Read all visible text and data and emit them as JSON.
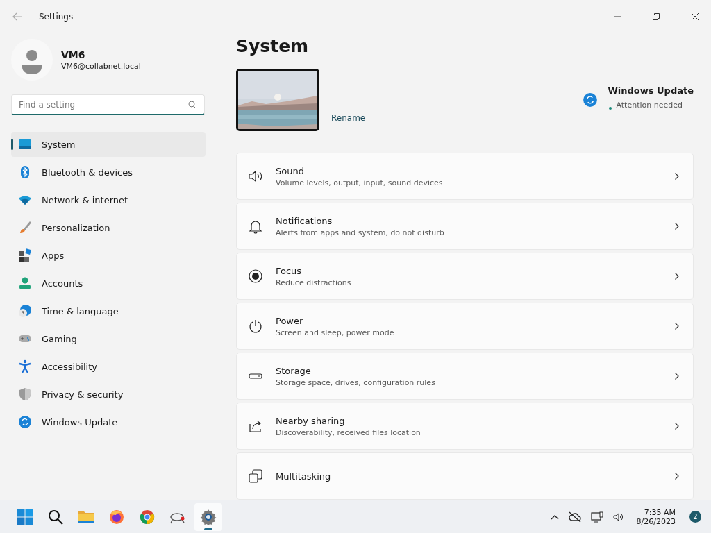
{
  "window": {
    "title": "Settings"
  },
  "account": {
    "name": "VM6",
    "email": "VM6@collabnet.local"
  },
  "search": {
    "placeholder": "Find a setting"
  },
  "nav": [
    {
      "label": "System",
      "kind": "system",
      "selected": true
    },
    {
      "label": "Bluetooth & devices",
      "kind": "bluetooth",
      "selected": false
    },
    {
      "label": "Network & internet",
      "kind": "network",
      "selected": false
    },
    {
      "label": "Personalization",
      "kind": "brush",
      "selected": false
    },
    {
      "label": "Apps",
      "kind": "apps",
      "selected": false
    },
    {
      "label": "Accounts",
      "kind": "accounts",
      "selected": false
    },
    {
      "label": "Time & language",
      "kind": "time",
      "selected": false
    },
    {
      "label": "Gaming",
      "kind": "gaming",
      "selected": false
    },
    {
      "label": "Accessibility",
      "kind": "accessibility",
      "selected": false
    },
    {
      "label": "Privacy & security",
      "kind": "shield",
      "selected": false
    },
    {
      "label": "Windows Update",
      "kind": "update",
      "selected": false
    }
  ],
  "page_title": "System",
  "device": {
    "rename": "Rename"
  },
  "update_status": {
    "title": "Windows Update",
    "status": "Attention needed"
  },
  "settings": [
    {
      "title": "Sound",
      "subtitle": "Volume levels, output, input, sound devices",
      "kind": "sound"
    },
    {
      "title": "Notifications",
      "subtitle": "Alerts from apps and system, do not disturb",
      "kind": "bell"
    },
    {
      "title": "Focus",
      "subtitle": "Reduce distractions",
      "kind": "focus"
    },
    {
      "title": "Power",
      "subtitle": "Screen and sleep, power mode",
      "kind": "power"
    },
    {
      "title": "Storage",
      "subtitle": "Storage space, drives, configuration rules",
      "kind": "storage"
    },
    {
      "title": "Nearby sharing",
      "subtitle": "Discoverability, received files location",
      "kind": "share"
    },
    {
      "title": "Multitasking",
      "kind": "multitask"
    }
  ],
  "taskbar": {
    "apps": [
      {
        "kind": "start",
        "selected": false
      },
      {
        "kind": "search",
        "selected": false
      },
      {
        "kind": "folder",
        "selected": false
      },
      {
        "kind": "firefox",
        "selected": false
      },
      {
        "kind": "chrome",
        "selected": false
      },
      {
        "kind": "network-tool",
        "selected": false
      },
      {
        "kind": "settings",
        "selected": true
      }
    ],
    "time": "7:35 AM",
    "date": "8/26/2023",
    "notifications": "2"
  }
}
